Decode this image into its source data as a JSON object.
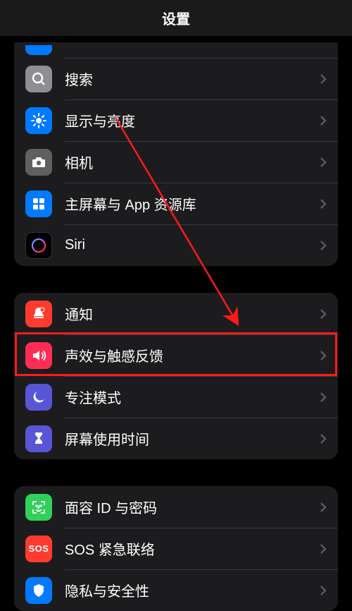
{
  "header": {
    "title": "设置"
  },
  "groups": [
    {
      "rows": [
        {
          "id": "partial",
          "label": ""
        },
        {
          "id": "search",
          "label": "搜索"
        },
        {
          "id": "display",
          "label": "显示与亮度"
        },
        {
          "id": "camera",
          "label": "相机"
        },
        {
          "id": "home",
          "label": "主屏幕与 App 资源库"
        },
        {
          "id": "siri",
          "label": "Siri"
        }
      ]
    },
    {
      "rows": [
        {
          "id": "notify",
          "label": "通知"
        },
        {
          "id": "sound",
          "label": "声效与触感反馈"
        },
        {
          "id": "focus",
          "label": "专注模式"
        },
        {
          "id": "screen",
          "label": "屏幕使用时间"
        }
      ]
    },
    {
      "rows": [
        {
          "id": "faceid",
          "label": "面容 ID 与密码"
        },
        {
          "id": "sos",
          "label": "SOS 紧急联络"
        },
        {
          "id": "privacy",
          "label": "隐私与安全性"
        }
      ]
    }
  ],
  "highlight_row": "sound",
  "icons": {
    "search": "search-icon",
    "display": "brightness-icon",
    "camera": "camera-icon",
    "home": "app-grid-icon",
    "siri": "siri-icon",
    "notify": "bell-icon",
    "sound": "speaker-icon",
    "focus": "moon-icon",
    "screen": "hourglass-icon",
    "faceid": "faceid-icon",
    "sos": "sos-icon",
    "privacy": "hand-icon"
  },
  "sos_text": "SOS"
}
